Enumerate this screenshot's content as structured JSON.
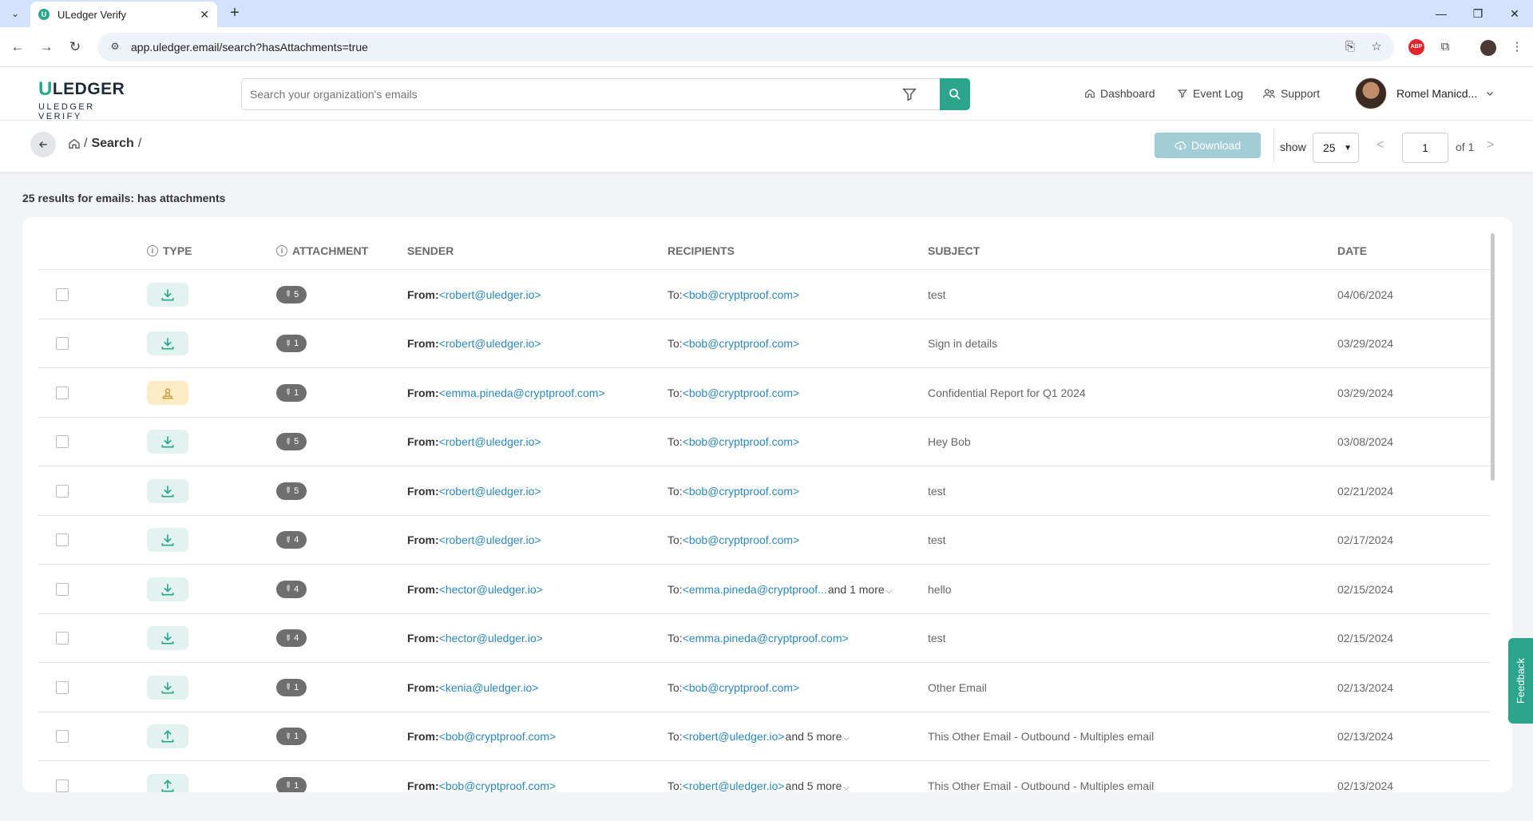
{
  "browser": {
    "tab_title": "ULedger Verify",
    "url": "app.uledger.email/search?hasAttachments=true"
  },
  "header": {
    "logo_main": "LEDGER",
    "logo_u": "U",
    "logo_sub": "ULEDGER VERIFY",
    "search_placeholder": "Search your organization's emails",
    "nav": [
      {
        "label": "Dashboard",
        "icon": "home-icon"
      },
      {
        "label": "Event Log",
        "icon": "filter-icon"
      },
      {
        "label": "Support",
        "icon": "users-icon"
      }
    ],
    "user_name": "Romel Manicd..."
  },
  "toolbar": {
    "breadcrumb_current": "Search",
    "breadcrumb_sep": "/",
    "download_label": "Download",
    "show_label": "show",
    "show_value": "25",
    "page_value": "1",
    "page_of": "of 1"
  },
  "results": {
    "count_text": "25 results for emails: has attachments",
    "columns": [
      "TYPE",
      "ATTACHMENT",
      "SENDER",
      "RECIPIENTS",
      "SUBJECT",
      "DATE"
    ],
    "from_label": "From:",
    "to_label": "To:",
    "rows": [
      {
        "type": "download",
        "attachments": "5",
        "sender": "<robert@uledger.io>",
        "recipient": "<bob@cryptproof.com>",
        "more": "",
        "subject": "test",
        "date": "04/06/2024"
      },
      {
        "type": "download",
        "attachments": "1",
        "sender": "<robert@uledger.io>",
        "recipient": "<bob@cryptproof.com>",
        "more": "",
        "subject": "Sign in details",
        "date": "03/29/2024"
      },
      {
        "type": "seal",
        "attachments": "1",
        "sender": "<emma.pineda@cryptproof.com>",
        "recipient": "<bob@cryptproof.com>",
        "more": "",
        "subject": "Confidential Report for Q1 2024",
        "date": "03/29/2024"
      },
      {
        "type": "download",
        "attachments": "5",
        "sender": "<robert@uledger.io>",
        "recipient": "<bob@cryptproof.com>",
        "more": "",
        "subject": "Hey Bob",
        "date": "03/08/2024"
      },
      {
        "type": "download",
        "attachments": "5",
        "sender": "<robert@uledger.io>",
        "recipient": "<bob@cryptproof.com>",
        "more": "",
        "subject": "test",
        "date": "02/21/2024"
      },
      {
        "type": "download",
        "attachments": "4",
        "sender": "<robert@uledger.io>",
        "recipient": "<bob@cryptproof.com>",
        "more": "",
        "subject": "test",
        "date": "02/17/2024"
      },
      {
        "type": "download",
        "attachments": "4",
        "sender": "<hector@uledger.io>",
        "recipient": "<emma.pineda@cryptproof...",
        "more": "and 1 more",
        "subject": "hello",
        "date": "02/15/2024"
      },
      {
        "type": "download",
        "attachments": "4",
        "sender": "<hector@uledger.io>",
        "recipient": "<emma.pineda@cryptproof.com>",
        "more": "",
        "subject": "test",
        "date": "02/15/2024"
      },
      {
        "type": "download",
        "attachments": "1",
        "sender": "<kenia@uledger.io>",
        "recipient": "<bob@cryptproof.com>",
        "more": "",
        "subject": "Other Email",
        "date": "02/13/2024"
      },
      {
        "type": "upload",
        "attachments": "1",
        "sender": "<bob@cryptproof.com>",
        "recipient": "<robert@uledger.io>",
        "more": "and 5 more",
        "subject": "This Other Email - Outbound - Multiples email",
        "date": "02/13/2024"
      },
      {
        "type": "upload",
        "attachments": "1",
        "sender": "<bob@cryptproof.com>",
        "recipient": "<robert@uledger.io>",
        "more": "and 5 more",
        "subject": "This Other Email - Outbound - Multiples email",
        "date": "02/13/2024"
      }
    ]
  },
  "feedback_label": "Feedback",
  "colors": {
    "brand": "#2ba58b",
    "link": "#2d87b7",
    "download_btn": "#a3cdd6"
  }
}
